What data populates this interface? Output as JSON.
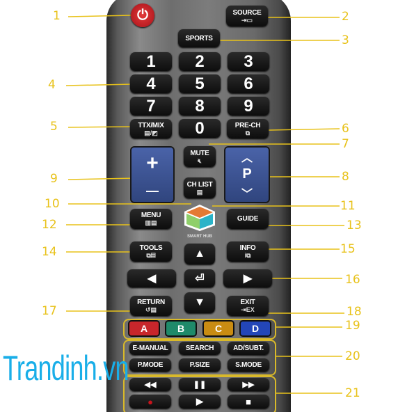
{
  "buttons": {
    "power": "⏻",
    "source": "SOURCE",
    "source_icon": "⇥▭",
    "sports": "SPORTS",
    "digits": [
      "1",
      "2",
      "3",
      "4",
      "5",
      "6",
      "7",
      "8",
      "9",
      "0"
    ],
    "ttx": "TTX/MIX",
    "ttx_icon": "▤/◩",
    "prech": "PRE-CH",
    "prech_icon": "⧉",
    "mute": "MUTE",
    "mute_icon": "🔇︎",
    "chlist": "CH LIST",
    "chlist_icon": "▤",
    "vol_up": "+",
    "vol_down": "—",
    "ch_up": "︿",
    "ch_p": "P",
    "ch_down": "﹀",
    "smart_hub": "SMART HUB",
    "menu": "MENU",
    "menu_icon": "▥▤",
    "guide": "GUIDE",
    "tools": "TOOLS",
    "tools_icon": "⧉▤",
    "info": "INFO",
    "info_icon": "i⧉",
    "up": "▲",
    "left": "◀",
    "enter": "⏎",
    "right": "▶",
    "down": "▼",
    "return": "RETURN",
    "return_icon": "↺▤",
    "exit": "EXIT",
    "exit_icon": "⇥EX",
    "colors": [
      {
        "label": "A",
        "color": "#c8262b"
      },
      {
        "label": "B",
        "color": "#1f8a6a"
      },
      {
        "label": "C",
        "color": "#c98c12"
      },
      {
        "label": "D",
        "color": "#2346b8"
      }
    ],
    "func": [
      "E-MANUAL",
      "SEARCH",
      "AD/SUBT.",
      "P.MODE",
      "P.SIZE",
      "S.MODE"
    ],
    "media": [
      "◀◀",
      "❚❚",
      "▶▶",
      "●",
      "▶",
      "■"
    ]
  },
  "callouts": [
    "1",
    "2",
    "3",
    "4",
    "5",
    "6",
    "7",
    "8",
    "9",
    "10",
    "11",
    "12",
    "13",
    "14",
    "15",
    "16",
    "17",
    "18",
    "19",
    "20",
    "21"
  ],
  "watermark": "Trandinh.vn",
  "colors": {
    "callout": "#e8c21a",
    "remote": "#6e6e6e",
    "rocker": "#3d55a0",
    "power": "#d0202a",
    "watermark": "#19aee8"
  }
}
